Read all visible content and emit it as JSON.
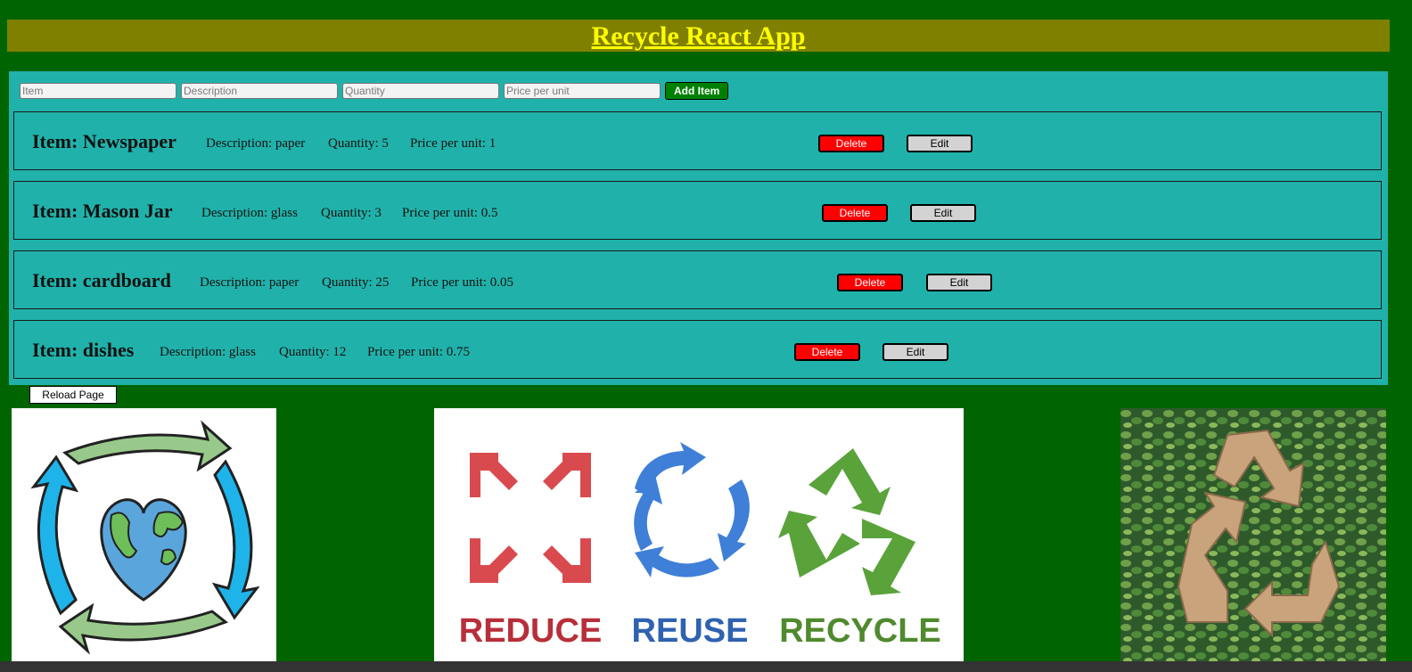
{
  "header": {
    "title": "Recycle React App"
  },
  "form": {
    "item_placeholder": "Item",
    "description_placeholder": "Description",
    "quantity_placeholder": "Quantity",
    "price_placeholder": "Price per unit",
    "add_label": "Add Item"
  },
  "items": [
    {
      "name": "Item: Newspaper",
      "description": "Description: paper",
      "quantity": "Quantity: 5",
      "price": "Price per unit: 1",
      "delete_label": "Delete",
      "edit_label": "Edit"
    },
    {
      "name": "Item: Mason Jar",
      "description": "Description: glass",
      "quantity": "Quantity: 3",
      "price": "Price per unit: 0.5",
      "delete_label": "Delete",
      "edit_label": "Edit"
    },
    {
      "name": "Item: cardboard",
      "description": "Description: paper",
      "quantity": "Quantity: 25",
      "price": "Price per unit: 0.05",
      "delete_label": "Delete",
      "edit_label": "Edit"
    },
    {
      "name": "Item: dishes",
      "description": "Description: glass",
      "quantity": "Quantity: 12",
      "price": "Price per unit: 0.75",
      "delete_label": "Delete",
      "edit_label": "Edit"
    }
  ],
  "reload_label": "Reload Page",
  "images": {
    "rrr_labels": [
      "REDUCE",
      "REUSE",
      "RECYCLE"
    ]
  },
  "colors": {
    "page_bg": "#006400",
    "header_bg": "#808000",
    "title": "#ffff00",
    "panel_bg": "#20b2aa",
    "delete": "#ff0000",
    "add": "#008000"
  }
}
